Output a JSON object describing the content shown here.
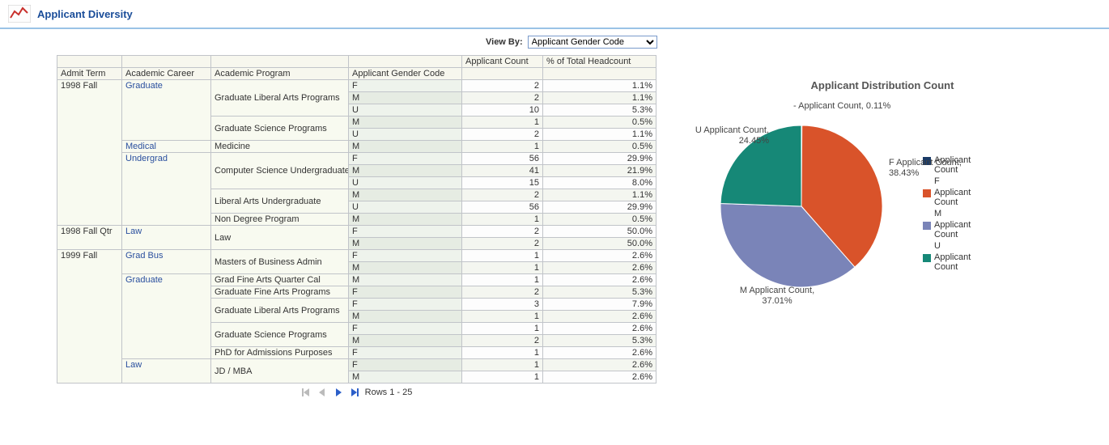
{
  "header": {
    "title": "Applicant Diversity"
  },
  "viewby": {
    "label": "View By:",
    "selected": "Applicant Gender Code"
  },
  "columns": {
    "admit_term": "Admit Term",
    "academic_career": "Academic Career",
    "academic_program": "Academic Program",
    "gender_code": "Applicant Gender Code",
    "applicant_count": "Applicant Count",
    "pct_headcount": "% of Total Headcount"
  },
  "rows": [
    {
      "term": "1998 Fall",
      "career": "Graduate",
      "program": "Graduate Liberal Arts Programs",
      "gender": "F",
      "count": 2,
      "pct": "1.1%"
    },
    {
      "term": "",
      "career": "",
      "program": "",
      "gender": "M",
      "count": 2,
      "pct": "1.1%"
    },
    {
      "term": "",
      "career": "",
      "program": "",
      "gender": "U",
      "count": 10,
      "pct": "5.3%"
    },
    {
      "term": "",
      "career": "",
      "program": "Graduate Science Programs",
      "gender": "M",
      "count": 1,
      "pct": "0.5%"
    },
    {
      "term": "",
      "career": "",
      "program": "",
      "gender": "U",
      "count": 2,
      "pct": "1.1%"
    },
    {
      "term": "",
      "career": "Medical",
      "program": "Medicine",
      "gender": "M",
      "count": 1,
      "pct": "0.5%"
    },
    {
      "term": "",
      "career": "Undergrad",
      "program": "Computer Science Undergraduate",
      "gender": "F",
      "count": 56,
      "pct": "29.9%"
    },
    {
      "term": "",
      "career": "",
      "program": "",
      "gender": "M",
      "count": 41,
      "pct": "21.9%"
    },
    {
      "term": "",
      "career": "",
      "program": "",
      "gender": "U",
      "count": 15,
      "pct": "8.0%"
    },
    {
      "term": "",
      "career": "",
      "program": "Liberal Arts Undergraduate",
      "gender": "M",
      "count": 2,
      "pct": "1.1%"
    },
    {
      "term": "",
      "career": "",
      "program": "",
      "gender": "U",
      "count": 56,
      "pct": "29.9%"
    },
    {
      "term": "",
      "career": "",
      "program": "Non Degree Program",
      "gender": "M",
      "count": 1,
      "pct": "0.5%"
    },
    {
      "term": "1998 Fall Qtr",
      "career": "Law",
      "program": "Law",
      "gender": "F",
      "count": 2,
      "pct": "50.0%"
    },
    {
      "term": "",
      "career": "",
      "program": "",
      "gender": "M",
      "count": 2,
      "pct": "50.0%"
    },
    {
      "term": "1999 Fall",
      "career": "Grad Bus",
      "program": "Masters of Business Admin",
      "gender": "F",
      "count": 1,
      "pct": "2.6%"
    },
    {
      "term": "",
      "career": "",
      "program": "",
      "gender": "M",
      "count": 1,
      "pct": "2.6%"
    },
    {
      "term": "",
      "career": "Graduate",
      "program": "Grad Fine Arts Quarter Cal",
      "gender": "M",
      "count": 1,
      "pct": "2.6%"
    },
    {
      "term": "",
      "career": "",
      "program": "Graduate Fine Arts Programs",
      "gender": "F",
      "count": 2,
      "pct": "5.3%"
    },
    {
      "term": "",
      "career": "",
      "program": "Graduate Liberal Arts Programs",
      "gender": "F",
      "count": 3,
      "pct": "7.9%"
    },
    {
      "term": "",
      "career": "",
      "program": "",
      "gender": "M",
      "count": 1,
      "pct": "2.6%"
    },
    {
      "term": "",
      "career": "",
      "program": "Graduate Science Programs",
      "gender": "F",
      "count": 1,
      "pct": "2.6%"
    },
    {
      "term": "",
      "career": "",
      "program": "",
      "gender": "M",
      "count": 2,
      "pct": "5.3%"
    },
    {
      "term": "",
      "career": "",
      "program": "PhD for Admissions Purposes",
      "gender": "F",
      "count": 1,
      "pct": "2.6%"
    },
    {
      "term": "",
      "career": "Law",
      "program": "JD / MBA",
      "gender": "F",
      "count": 1,
      "pct": "2.6%"
    },
    {
      "term": "",
      "career": "",
      "program": "",
      "gender": "M",
      "count": 1,
      "pct": "2.6%"
    }
  ],
  "career_links": [
    "Graduate",
    "Medical",
    "Undergrad",
    "Law",
    "Grad Bus"
  ],
  "pager": {
    "rows_text": "Rows 1 - 25"
  },
  "chart": {
    "title": "Applicant Distribution Count",
    "labels": {
      "top": "- Applicant Count, 0.11%",
      "u": "U Applicant Count, 24.45%",
      "f": "F Applicant Count, 38.43%",
      "m": "M Applicant Count, 37.01%"
    },
    "legend": [
      {
        "color": "#1a3a66",
        "label1": "Applicant",
        "label2": "Count"
      },
      {
        "color": "",
        "label1": "F",
        "label2": ""
      },
      {
        "color": "#d9532a",
        "label1": "Applicant",
        "label2": "Count"
      },
      {
        "color": "",
        "label1": "M",
        "label2": ""
      },
      {
        "color": "#7a84b8",
        "label1": "Applicant",
        "label2": "Count"
      },
      {
        "color": "",
        "label1": "U",
        "label2": ""
      },
      {
        "color": "#168877",
        "label1": "Applicant",
        "label2": "Count"
      }
    ]
  },
  "chart_data": {
    "type": "pie",
    "title": "Applicant Distribution Count",
    "series": [
      {
        "name": "- Applicant Count",
        "value": 0.11,
        "color": "#1a3a66"
      },
      {
        "name": "F Applicant Count",
        "value": 38.43,
        "color": "#d9532a"
      },
      {
        "name": "M Applicant Count",
        "value": 37.01,
        "color": "#7a84b8"
      },
      {
        "name": "U Applicant Count",
        "value": 24.45,
        "color": "#168877"
      }
    ]
  }
}
